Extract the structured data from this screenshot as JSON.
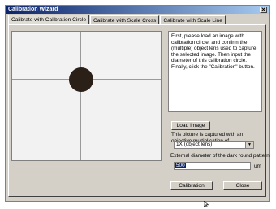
{
  "window": {
    "title": "Calibration Wizard",
    "close_glyph": "✕"
  },
  "tabs": [
    {
      "label": "Calibrate with Calibration Circle",
      "active": true
    },
    {
      "label": "Calibrate with Scale Cross",
      "active": false
    },
    {
      "label": "Calibrate with Scale Line",
      "active": false
    }
  ],
  "instructions": "First, please load an image with calibration circle, and confirm the (multiple) object lens used to capture the selected image. Then input the diameter of this calibration circle. Finally, click the \"Calibration\" button.",
  "load_button": "Load Image",
  "objective_label": "This picture is captured with an objective multiplication of",
  "objective_select": {
    "value": "1X (object lens)",
    "arrow_glyph": "▼"
  },
  "diameter_label": "External diameter of the dark round pattern",
  "diameter_input": {
    "value": "500"
  },
  "unit": "um",
  "calibration_button": "Calibration",
  "close_button": "Close",
  "colors": {
    "window_bg": "#d4d0c8",
    "title_bar": "#0a246a",
    "selection": "#0a246a",
    "circle": "#2b2018"
  },
  "icons": {
    "close": "close-icon",
    "dropdown": "chevron-down-icon",
    "cursor": "mouse-cursor-icon"
  }
}
